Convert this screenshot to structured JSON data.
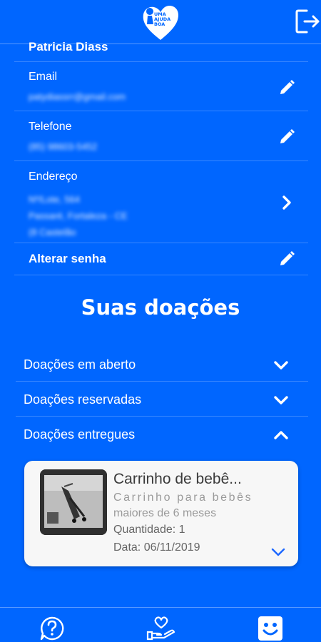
{
  "app": {
    "logo_text": [
      "UMA",
      "AJUDA",
      "BOA"
    ],
    "logo_icon": "heart-logo-icon",
    "logout_icon": "logout-icon"
  },
  "profile": {
    "name": "Patricia Diass",
    "fields": [
      {
        "label": "Email",
        "value": "patydiassrr@gmail.com",
        "action_icon": "pencil-icon"
      },
      {
        "label": "Telefone",
        "value": "(85) 98603-5452",
        "action_icon": "pencil-icon"
      },
      {
        "label": "Endereço",
        "value_lines": [
          "Nº/Lote, 564",
          "Passaré, Fortaleza - CE",
          "(8 Castelão"
        ],
        "action_icon": "chevron-right-icon"
      }
    ],
    "change_password": {
      "label": "Alterar senha",
      "action_icon": "pencil-icon"
    }
  },
  "donations": {
    "title": "Suas doações",
    "sections": [
      {
        "label": "Doações em aberto",
        "state": "collapsed"
      },
      {
        "label": "Doações reservadas",
        "state": "collapsed"
      },
      {
        "label": "Doações entregues",
        "state": "expanded"
      }
    ],
    "delivered_item": {
      "title": "Carrinho de bebê...",
      "description_line1": "Carrinho para bebês",
      "description_line2": "maiores de 6 meses",
      "quantity": "Quantidade: 1",
      "date": "Data: 06/11/2019"
    }
  },
  "bottom_nav": {
    "items": [
      {
        "icon": "help-circle-icon"
      },
      {
        "icon": "donate-hand-heart-icon"
      },
      {
        "icon": "smiley-profile-icon",
        "active": true
      }
    ]
  },
  "colors": {
    "background": "#0066ff",
    "card": "#f7f7f7",
    "accent_chevron": "#1a66ff"
  }
}
